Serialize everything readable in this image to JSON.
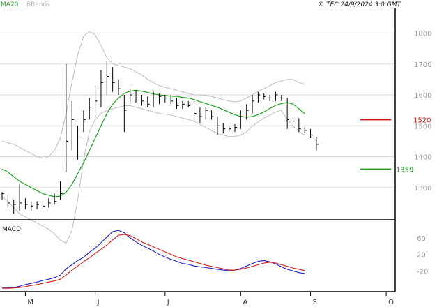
{
  "header": {
    "legend": [
      "MA20",
      "BBands"
    ],
    "copyright": "© TEC 24/9/2024 3:0 GMT"
  },
  "colors": {
    "ma": "#22a022",
    "bbands": "#bdbdbd",
    "price_bar": "#000000",
    "macd": "#1f1fc8",
    "signal": "#d11c1c",
    "resistance": "#cc1111",
    "support": "#1f9a1f",
    "grid": "#d8d8d8",
    "axis": "#000000"
  },
  "chart_data": [
    {
      "type": "ohlc",
      "title": "",
      "overlays": [
        "MA20",
        "BBands"
      ],
      "y_ticks": [
        1300,
        1400,
        1500,
        1600,
        1700,
        1800
      ],
      "ylim": [
        1200,
        1860
      ],
      "x_ticks": [
        {
          "label": "M",
          "i": 4
        },
        {
          "label": "J",
          "i": 16
        },
        {
          "label": "J",
          "i": 28
        },
        {
          "label": "A",
          "i": 41
        },
        {
          "label": "S",
          "i": 53
        },
        {
          "label": "O",
          "i": 66
        }
      ],
      "x_count": 67,
      "grid": true,
      "bars": [
        [
          1285,
          1260,
          1280
        ],
        [
          1275,
          1235,
          1250
        ],
        [
          1260,
          1215,
          1245
        ],
        [
          1310,
          1225,
          1250
        ],
        [
          1265,
          1230,
          1245
        ],
        [
          1255,
          1225,
          1240
        ],
        [
          1255,
          1230,
          1245
        ],
        [
          1250,
          1230,
          1240
        ],
        [
          1265,
          1235,
          1250
        ],
        [
          1280,
          1245,
          1255
        ],
        [
          1320,
          1260,
          1280
        ],
        [
          1700,
          1350,
          1450
        ],
        [
          1580,
          1420,
          1520
        ],
        [
          1500,
          1390,
          1470
        ],
        [
          1550,
          1480,
          1520
        ],
        [
          1590,
          1520,
          1560
        ],
        [
          1630,
          1530,
          1580
        ],
        [
          1680,
          1560,
          1640
        ],
        [
          1710,
          1600,
          1660
        ],
        [
          1690,
          1610,
          1640
        ],
        [
          1650,
          1600,
          1620
        ],
        [
          1480,
          1600,
          1550
        ],
        [
          1620,
          1570,
          1600
        ],
        [
          1615,
          1575,
          1590
        ],
        [
          1600,
          1565,
          1580
        ],
        [
          1595,
          1560,
          1570
        ],
        [
          1610,
          1560,
          1590
        ],
        [
          1605,
          1570,
          1595
        ],
        [
          1600,
          1575,
          1590
        ],
        [
          1600,
          1570,
          1580
        ],
        [
          1590,
          1555,
          1565
        ],
        [
          1580,
          1555,
          1570
        ],
        [
          1580,
          1560,
          1565
        ],
        [
          1580,
          1510,
          1540
        ],
        [
          1560,
          1510,
          1530
        ],
        [
          1560,
          1520,
          1550
        ],
        [
          1550,
          1520,
          1530
        ],
        [
          1530,
          1470,
          1500
        ],
        [
          1510,
          1475,
          1490
        ],
        [
          1500,
          1480,
          1490
        ],
        [
          1505,
          1480,
          1495
        ],
        [
          1550,
          1490,
          1530
        ],
        [
          1570,
          1520,
          1550
        ],
        [
          1600,
          1540,
          1580
        ],
        [
          1610,
          1575,
          1600
        ],
        [
          1605,
          1585,
          1595
        ],
        [
          1600,
          1580,
          1590
        ],
        [
          1610,
          1580,
          1600
        ],
        [
          1600,
          1580,
          1590
        ],
        [
          1590,
          1490,
          1520
        ],
        [
          1525,
          1505,
          1515
        ],
        [
          1525,
          1480,
          1490
        ],
        [
          1495,
          1475,
          1485
        ],
        [
          1490,
          1460,
          1470
        ],
        [
          1465,
          1420,
          1440
        ]
      ],
      "ma20": [
        1360,
        1350,
        1335,
        1320,
        1310,
        1300,
        1290,
        1280,
        1275,
        1270,
        1272,
        1285,
        1310,
        1345,
        1380,
        1420,
        1460,
        1500,
        1540,
        1570,
        1590,
        1605,
        1612,
        1615,
        1612,
        1608,
        1603,
        1600,
        1598,
        1596,
        1595,
        1592,
        1590,
        1585,
        1578,
        1572,
        1566,
        1560,
        1552,
        1544,
        1536,
        1530,
        1528,
        1530,
        1536,
        1545,
        1556,
        1566,
        1572,
        1575,
        1570,
        1555,
        1540
      ],
      "bb_upper": [
        1450,
        1445,
        1440,
        1430,
        1420,
        1410,
        1400,
        1395,
        1400,
        1420,
        1460,
        1540,
        1640,
        1730,
        1790,
        1805,
        1795,
        1760,
        1720,
        1700,
        1695,
        1690,
        1685,
        1675,
        1665,
        1650,
        1640,
        1630,
        1625,
        1620,
        1615,
        1610,
        1605,
        1600,
        1600,
        1598,
        1595,
        1590,
        1585,
        1580,
        1578,
        1580,
        1590,
        1600,
        1612,
        1620,
        1630,
        1640,
        1645,
        1650,
        1650,
        1640,
        1635
      ],
      "bb_lower": [
        1270,
        1255,
        1235,
        1215,
        1205,
        1195,
        1185,
        1175,
        1165,
        1150,
        1130,
        1120,
        1160,
        1260,
        1390,
        1480,
        1520,
        1540,
        1550,
        1555,
        1560,
        1565,
        1565,
        1560,
        1555,
        1550,
        1545,
        1540,
        1538,
        1535,
        1530,
        1525,
        1520,
        1515,
        1505,
        1495,
        1485,
        1475,
        1470,
        1465,
        1465,
        1470,
        1480,
        1500,
        1512,
        1525,
        1535,
        1545,
        1550,
        1520,
        1500,
        1480,
        1470
      ],
      "levels": [
        {
          "value": 1520,
          "label": "1520",
          "color": "resistance"
        },
        {
          "value": 1359,
          "label": "1359",
          "color": "support"
        }
      ]
    },
    {
      "type": "line",
      "title": "MACD",
      "y_ticks_labels": [
        "60",
        "20",
        "-20"
      ],
      "y_ticks_values": [
        60,
        20,
        -20
      ],
      "ylim": [
        -70,
        100
      ],
      "series": [
        {
          "key": "macd",
          "values": [
            -61,
            -61,
            -60,
            -57,
            -53,
            -50,
            -47,
            -43,
            -40,
            -36,
            -30,
            -15,
            -5,
            5,
            13,
            25,
            35,
            48,
            62,
            75,
            78,
            72,
            60,
            50,
            42,
            35,
            28,
            20,
            14,
            8,
            3,
            -2,
            -4,
            -8,
            -10,
            -12,
            -14,
            -16,
            -18,
            -20,
            -18,
            -14,
            -8,
            -2,
            3,
            5,
            2,
            -3,
            -10,
            -16,
            -20,
            -24,
            -26
          ]
        },
        {
          "key": "signal",
          "values": [
            -62,
            -62,
            -61,
            -60,
            -58,
            -55,
            -53,
            -50,
            -47,
            -44,
            -40,
            -30,
            -18,
            -8,
            2,
            12,
            22,
            32,
            43,
            55,
            66,
            68,
            65,
            58,
            50,
            44,
            38,
            32,
            26,
            20,
            14,
            10,
            6,
            2,
            -2,
            -6,
            -9,
            -12,
            -15,
            -18,
            -18,
            -16,
            -13,
            -9,
            -5,
            -1,
            1,
            -1,
            -5,
            -9,
            -13,
            -16,
            -19
          ]
        }
      ]
    }
  ]
}
